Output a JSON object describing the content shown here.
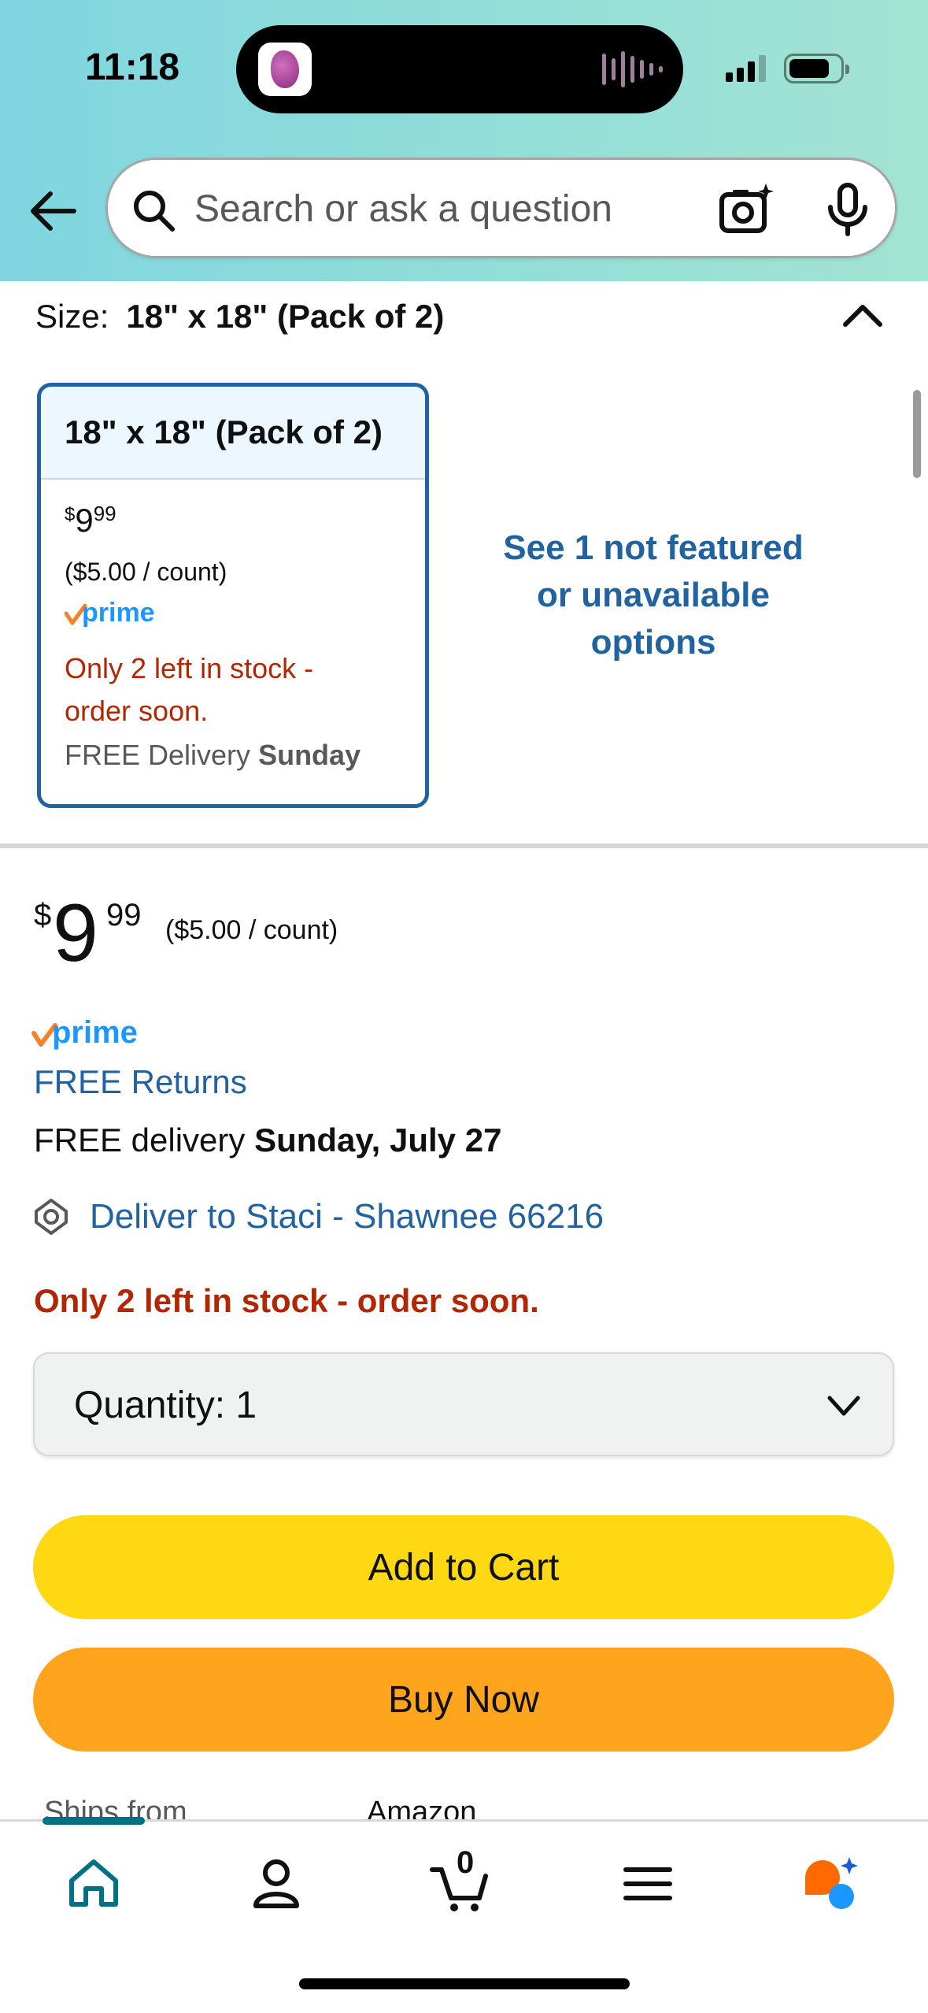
{
  "status_bar": {
    "time": "11:18"
  },
  "search": {
    "placeholder": "Search or ask a question"
  },
  "size": {
    "label": "Size:",
    "value": "18\" x 18\" (Pack of 2)"
  },
  "size_card": {
    "title": "18\" x 18\" (Pack of 2)",
    "price_symbol": "$",
    "price_whole": "9",
    "price_fraction": "99",
    "unit_price": "($5.00 / count)",
    "stock_line1": "Only 2 left in stock -",
    "stock_line2": "order soon.",
    "delivery_prefix": "FREE Delivery",
    "delivery_day": "Sunday"
  },
  "see_options": {
    "line1": "See 1 not featured",
    "line2": "or unavailable",
    "line3": "options"
  },
  "buybox": {
    "price_symbol": "$",
    "price_whole": "9",
    "price_fraction": "99",
    "unit_price": "($5.00 / count)",
    "free_returns": "FREE Returns",
    "delivery_prefix": "FREE delivery",
    "delivery_date": "Sunday, July 27",
    "deliver_to": "Deliver to Staci - Shawnee 66216",
    "stock": "Only 2 left in stock - order soon.",
    "quantity_label": "Quantity:  1",
    "add_to_cart": "Add to Cart",
    "buy_now": "Buy Now",
    "ships_from_label": "Ships from",
    "ships_from_value": "Amazon"
  },
  "tabbar": {
    "cart_count": "0"
  },
  "colors": {
    "link": "#2162a1",
    "stock": "#b12704",
    "add_to_cart": "#ffd814",
    "buy_now": "#ffa41c",
    "prime_blue": "#1a98ff",
    "prime_check": "#f7802a"
  }
}
